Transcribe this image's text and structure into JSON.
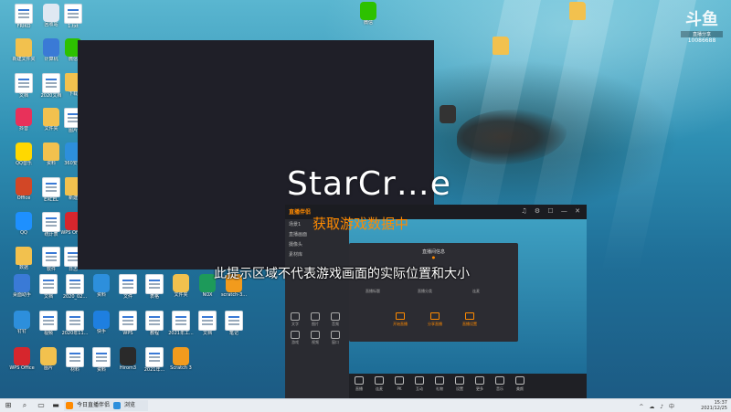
{
  "desktop": {
    "icons": [
      {
        "label": "FRIKO",
        "kind": "doc",
        "color": "#ffffff"
      },
      {
        "label": "回收站",
        "kind": "app",
        "color": "#dfe8f2"
      },
      {
        "label": "1.txt",
        "kind": "doc",
        "color": "#ffffff"
      },
      {
        "label": "新建文件夹",
        "kind": "folder",
        "color": "#f2c14e"
      },
      {
        "label": "计算机",
        "kind": "app",
        "color": "#3a7ad6"
      },
      {
        "label": "微信",
        "kind": "app",
        "color": "#2dc100"
      },
      {
        "label": "文档",
        "kind": "doc",
        "color": "#ffffff"
      },
      {
        "label": "2020文档",
        "kind": "doc",
        "color": "#ffffff"
      },
      {
        "label": "下载",
        "kind": "folder",
        "color": "#f2c14e"
      },
      {
        "label": "抖音",
        "kind": "app",
        "color": "#e8315a"
      },
      {
        "label": "文件夹",
        "kind": "folder",
        "color": "#f2c14e"
      },
      {
        "label": "图片",
        "kind": "doc",
        "color": "#ffffff"
      },
      {
        "label": "QQ音乐",
        "kind": "app",
        "color": "#ffd800"
      },
      {
        "label": "资料",
        "kind": "folder",
        "color": "#f2c14e"
      },
      {
        "label": "360安全",
        "kind": "app",
        "color": "#2d8fdc"
      },
      {
        "label": "Office",
        "kind": "app",
        "color": "#d24726"
      },
      {
        "label": "EXCEL",
        "kind": "doc",
        "color": "#ffffff"
      },
      {
        "label": "新建",
        "kind": "folder",
        "color": "#f2c14e"
      },
      {
        "label": "QQ",
        "kind": "app",
        "color": "#1e90ff"
      },
      {
        "label": "统计表",
        "kind": "doc",
        "color": "#ffffff"
      },
      {
        "label": "WPS Office",
        "kind": "app",
        "color": "#d6262d"
      },
      {
        "label": "数据",
        "kind": "folder",
        "color": "#f2c14e"
      },
      {
        "label": "软件",
        "kind": "doc",
        "color": "#ffffff"
      },
      {
        "label": "日志",
        "kind": "doc",
        "color": "#ffffff"
      }
    ],
    "bottom_icons": [
      {
        "label": "桌面助手",
        "color": "#3a7ad6"
      },
      {
        "label": "文档",
        "color": "#ffffff"
      },
      {
        "label": "2020_02...",
        "color": "#ffffff"
      },
      {
        "label": "资料",
        "color": "#2d8fdc"
      },
      {
        "label": "文件",
        "color": "#ffffff"
      },
      {
        "label": "表格",
        "color": "#ffffff"
      },
      {
        "label": "文件夹",
        "color": "#f2c14e"
      },
      {
        "label": "NOX",
        "color": "#1d9a5a"
      },
      {
        "label": "scratch-3...",
        "color": "#f29b1d"
      },
      {
        "label": "钉钉",
        "color": "#2d8fdc"
      },
      {
        "label": "视频",
        "color": "#ffffff"
      },
      {
        "label": "2020年11...",
        "color": "#ffffff"
      },
      {
        "label": "快手",
        "color": "#1e7fe0"
      },
      {
        "label": "WPS",
        "color": "#ffffff"
      },
      {
        "label": "教程",
        "color": "#ffffff"
      },
      {
        "label": "2021年工...",
        "color": "#ffffff"
      },
      {
        "label": "文档",
        "color": "#ffffff"
      },
      {
        "label": "笔记",
        "color": "#ffffff"
      },
      {
        "label": "WPS Office",
        "color": "#d6262d"
      },
      {
        "label": "图片",
        "color": "#f2c14e"
      },
      {
        "label": "材料",
        "color": "#ffffff"
      },
      {
        "label": "资料",
        "color": "#ffffff"
      },
      {
        "label": "Hirom3",
        "color": "#2a2a2a"
      },
      {
        "label": "2021年...",
        "color": "#ffffff"
      },
      {
        "label": "Scratch 3",
        "color": "#f29b1d"
      }
    ],
    "top_right_icon": {
      "label": "微信",
      "color": "#2dc100"
    }
  },
  "overlay": {
    "game_title": "StarCr…e",
    "loading_tip": "获取游戏数据中",
    "area_tip": "此提示区域不代表游戏画面的实际位置和大小"
  },
  "helper_window": {
    "logo": "直播伴侣",
    "controls": "♫ ⚙ ☐ — ✕",
    "sidebar_items": [
      "场景1",
      "直播画面",
      "摄像头",
      "素材库"
    ],
    "tools": [
      "文字",
      "图片",
      "音频",
      "游戏",
      "视频",
      "窗口"
    ],
    "dialog_title": "直播间信息",
    "dialog_subtitle": "●",
    "dialog_rows": [
      "直播标题",
      "直播分类",
      "连麦"
    ],
    "dialog_buttons": [
      "开始直播",
      "分享直播",
      "直播设置"
    ],
    "bottom_bar": [
      "直播",
      "连麦",
      "PK",
      "互动",
      "礼物",
      "设置",
      "更多",
      "音乐",
      "美颜"
    ]
  },
  "watermark": {
    "logo": "斗鱼",
    "sub": "直播分享",
    "room": "10086688"
  },
  "taskbar": {
    "apps": [
      {
        "label": "今日直播伴侣",
        "color": "#ff8a00"
      },
      {
        "label": "浏览",
        "color": "#2d8fdc"
      }
    ],
    "tray_icons": "^ ☁ ♪ 中",
    "clock_time": "15:37",
    "clock_date": "2021/12/25"
  }
}
